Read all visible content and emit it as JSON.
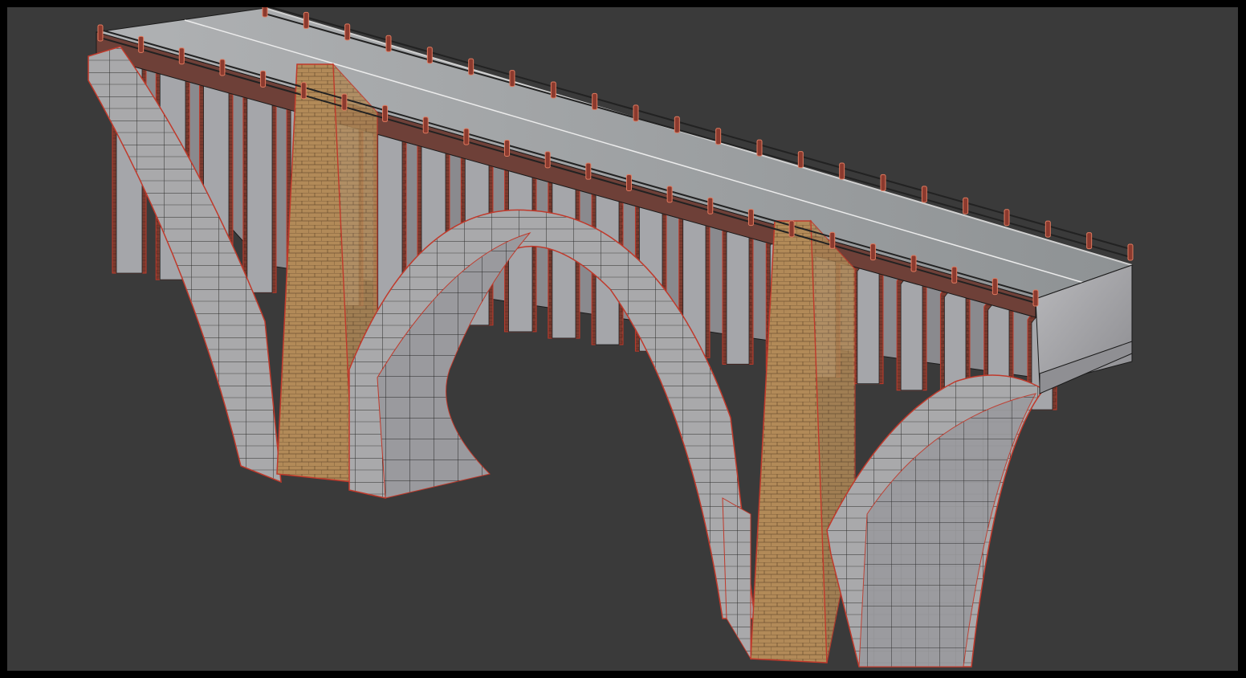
{
  "viewport": {
    "type": "3d-viewport",
    "background_color": "#3a3a3a",
    "border_color": "#000000",
    "shading_mode": "textured-with-wireframe",
    "wireframe_color": "#c0392b",
    "edge_color": "#1a1a1a"
  },
  "scene": {
    "object": "arch-bridge",
    "materials": {
      "stone": "#a8a8aa",
      "stone_dark": "#8c8c90",
      "brick": "#b48a55",
      "rail": "#8b3a2e",
      "deck": "#9a9ea0"
    },
    "main_arches": 2,
    "piers": 2
  }
}
